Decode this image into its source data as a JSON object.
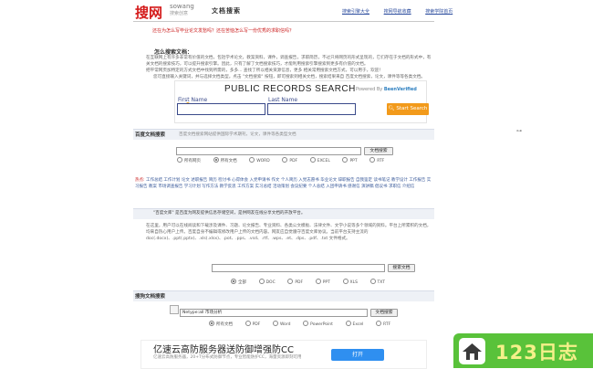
{
  "header": {
    "logo_main": "搜网",
    "logo_en": "sowang",
    "logo_slogan": "搜索创意",
    "doc_search_title": "文档搜索",
    "links": [
      "搜索引擎大全",
      "搜网导航收藏",
      "搜索学院首页"
    ]
  },
  "notice": "还在为怎么写毕业论文发愁吗？还在苦恼怎么写一份优秀的求职信吗？",
  "how_to": {
    "heading": "怎么搜索文档：",
    "para1": "在互联网上有许多非常有价值的文档，包括学术论文，教案资料，课件，调查报告，求职简历，不过只将网页的形式呈现的，它们存在于文档的形式中，有关文档的搜索技巧，可以提升搜索引擎。因此，只有了解了文档搜索技巧，才能利用搜索引擎搜索到更多有价值的文档。",
    "para2": "把平常网页加特定的方式文档中找到所需的，多多... 查找了所以相关资源信息，更多 相关常用搜索文档方式，可以用于，欢迎！",
    "para3": "您可直接输入关键词，并与选择文档类型。点击 \"文档搜索\" 按钮，即可搜索到相关文档，搜索结果来自 百度文档搜索，论文，课件等等各类文档。"
  },
  "ad_public_records": {
    "title": "PUBLIC RECORDS SEARCH",
    "powered_by": "Powered By",
    "brand": "BeenVerified",
    "first_name_label": "First Name",
    "last_name_label": "Last Name",
    "button": "Start Search"
  },
  "baidu": {
    "title": "百度文档搜索",
    "desc": "百度文档搜索网站提供国际学术期刊，论文，课件等各类型文档",
    "button": "文档搜索",
    "types": [
      "所有网页",
      "所有文档",
      "WORD",
      "PDF",
      "EXCEL",
      "PPT",
      "RTF"
    ]
  },
  "hot": {
    "label": "热点:",
    "items": "工作总结 工作计划 论文 述职报告 简历 检讨书 心得体会 入党申请书 作文 个人简历 入党志愿书 毕业论文 辞职报告 自我鉴定 读书笔记 教学设计 工作报告 实习报告 教案 市场调查报告 学习计划 写作方法 教学反思 工作方案 实习总结 活动策划 会议纪要 个人总结 入团申请书 感谢信 演讲稿 倡议书 求职信 介绍信"
  },
  "sina": {
    "title": "\"百度文库\" 是百度为网友提供信息存储空间，是供网友在线分享文档的开放平台。",
    "para": "在这里，用户可以在线阅读和下载涉及课件、习题、论文报告、专业资料、各类公文模板、法律文件、文学小说等多个领域的资料。平台上所累积的文档，均来自热心用户上传。百度自身不编辑或修改用户上传的文档内容。网友应自觉遵守百度文库协议。当前平台支持主流的 doc(.docx)、.ppt(.pptx)、.xls(.xlsx)、.pot、.pps、.vsd、.rtf、.wps、.et、.dps、.pdf、.txt 文件格式。",
    "button": "搜索文档",
    "types": [
      "全部",
      "DOC",
      "PDF",
      "PPT",
      "XLS",
      "TXT"
    ]
  },
  "sougou": {
    "title": "搜狗文档搜索",
    "input_value": "Netype:all 市场分析",
    "button": "文档搜索",
    "types": [
      "所有文档",
      "PDF",
      "Word",
      "PowerPoint",
      "Excel",
      "RTF"
    ]
  },
  "bottom_ad": {
    "headline": "亿速云高防服务器送防御增强防CC",
    "sub": "亿速云高防服务器，20+T分布式防御节点，专业智能防护CC，海量资源即刻可用",
    "button": "打开"
  },
  "watermark": {
    "text": "123日志"
  }
}
